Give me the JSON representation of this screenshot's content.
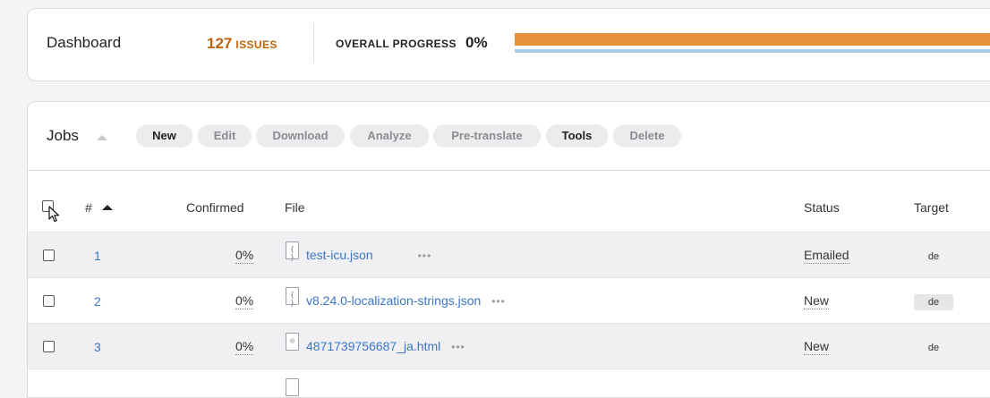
{
  "dashboard": {
    "title": "Dashboard",
    "issues_count": "127",
    "issues_label": "ISSUES",
    "progress_label": "OVERALL PROGRESS",
    "progress_value": "0%",
    "progress_fraction": 0.0,
    "colors": {
      "issues": "#c0630a",
      "bar": "#e8903a",
      "bar_track": "#a9cce6"
    }
  },
  "jobs": {
    "title": "Jobs",
    "toolbar": {
      "new": "New",
      "edit": "Edit",
      "download": "Download",
      "analyze": "Analyze",
      "pretranslate": "Pre-translate",
      "tools": "Tools",
      "delete": "Delete"
    },
    "columns": {
      "number": "#",
      "confirmed": "Confirmed",
      "file": "File",
      "status": "Status",
      "target": "Target"
    },
    "rows": [
      {
        "number": "1",
        "confirmed": "0%",
        "file": "test-icu.json",
        "file_icon": "json-file-icon",
        "status": "Emailed",
        "target": "de"
      },
      {
        "number": "2",
        "confirmed": "0%",
        "file": "v8.24.0-localization-strings.json",
        "file_icon": "json-file-icon",
        "status": "New",
        "target": "de"
      },
      {
        "number": "3",
        "confirmed": "0%",
        "file": "4871739756687_ja.html",
        "file_icon": "html-file-icon",
        "status": "New",
        "target": "de"
      }
    ]
  }
}
